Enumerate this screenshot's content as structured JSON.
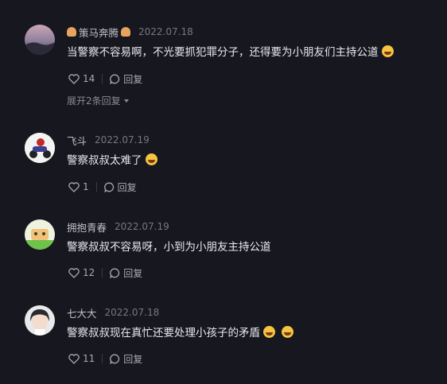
{
  "comments": [
    {
      "name": "策马奔腾",
      "date": "2022.07.18",
      "text": "当警察不容易啊，不光要抓犯罪分子，还得要为小朋友们主持公道",
      "likes": "14",
      "reply_label": "回复",
      "expand_label": "展开2条回复"
    },
    {
      "name": "飞斗",
      "date": "2022.07.19",
      "text": "警察叔叔太难了",
      "likes": "1",
      "reply_label": "回复"
    },
    {
      "name": "拥抱青春",
      "date": "2022.07.19",
      "text": "警察叔叔不容易呀，小到为小朋友主持公道",
      "likes": "12",
      "reply_label": "回复"
    },
    {
      "name": "七大大",
      "date": "2022.07.18",
      "text": "警察叔叔现在真忙还要处理小孩子的矛盾",
      "likes": "11",
      "reply_label": "回复"
    }
  ]
}
